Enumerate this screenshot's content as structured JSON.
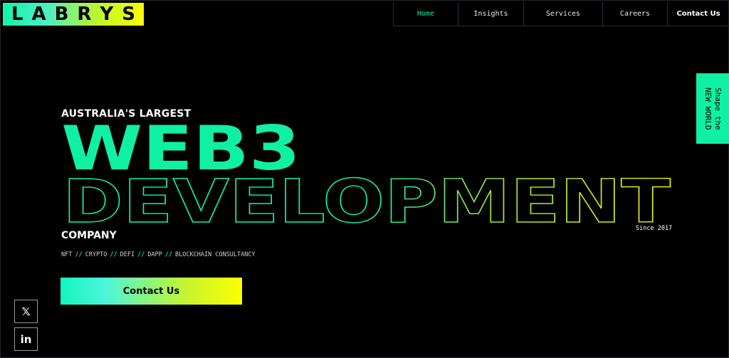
{
  "header": {
    "logo_letters": [
      "L",
      "A",
      "B",
      "R",
      "Y",
      "S"
    ],
    "nav": [
      {
        "label": "Home"
      },
      {
        "label": "Insights"
      },
      {
        "label": "Services"
      },
      {
        "label": "Careers"
      },
      {
        "label": "Contact Us"
      }
    ]
  },
  "hero": {
    "pre_title": "AUSTRALIA'S LARGEST",
    "title_main": "WEB3",
    "title_outline": "DEVELOPMENT",
    "company": "COMPANY",
    "since": "Since 2017",
    "tags": [
      "NFT",
      "CRYPTO",
      "DEFI",
      "DAPP",
      "BLOCKCHAIN CONSULTANCY"
    ],
    "tag_separator": "//",
    "cta_label": "Contact Us"
  },
  "side_tab": {
    "text": "Shape the\nNEW WORLD"
  },
  "social": {
    "x_glyph": "𝕏",
    "linkedin_glyph": "in"
  },
  "colors": {
    "accent_green": "#10f0a4",
    "accent_yellow": "#fcff00",
    "background": "#000000"
  }
}
